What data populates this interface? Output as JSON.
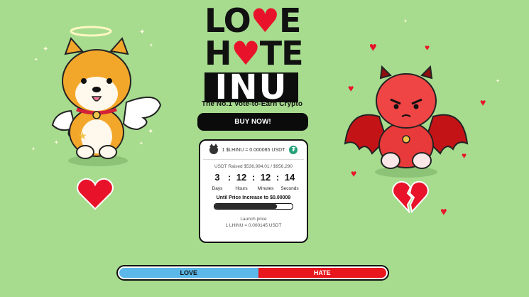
{
  "logo": {
    "line1_a": "LO",
    "line1_b": "E",
    "line2_a": "H",
    "line2_b": "TE",
    "line3": "INU"
  },
  "tagline": "The No.1 Vote-to-Earn Crypto",
  "buy_button": "BUY NOW!",
  "presale": {
    "price": "1 $LHINU = 0.000085 USDT",
    "raised": "USDT Raised $536,994.01 / $956,290",
    "countdown": [
      {
        "value": "3",
        "label": "Days"
      },
      {
        "value": "12",
        "label": "Hours"
      },
      {
        "value": "12",
        "label": "Minutes"
      },
      {
        "value": "14",
        "label": "Seconds"
      }
    ],
    "until_text": "Until Price Increase to $0.00009",
    "progress_fraction": 0.8,
    "launch_label": "Launch price",
    "launch_value": "1 LHINU = 0.000145 USDT"
  },
  "vote": {
    "love_label": "LOVE",
    "hate_label": "HATE",
    "love_fraction": 0.52
  },
  "colors": {
    "background": "#a7dc8f",
    "love": "#5bb8e8",
    "hate": "#e8161d",
    "heart": "#e8132a"
  }
}
